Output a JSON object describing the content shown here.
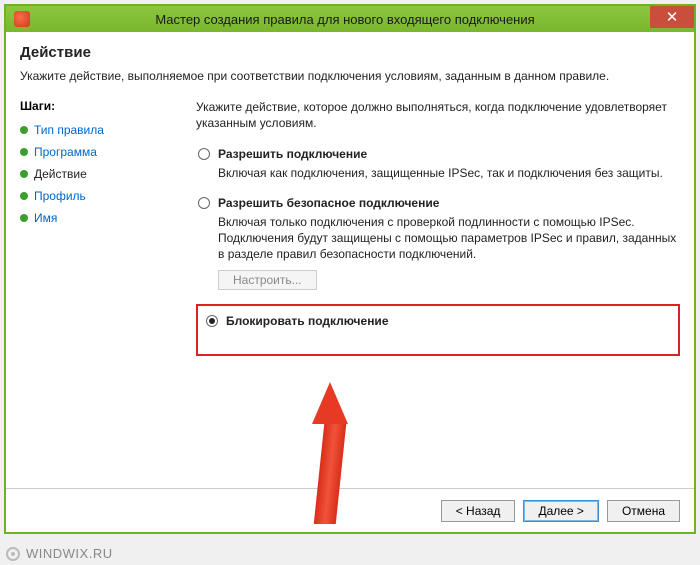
{
  "window": {
    "title": "Мастер создания правила для нового входящего подключения"
  },
  "header": {
    "title": "Действие",
    "subtitle": "Укажите действие, выполняемое при соответствии подключения условиям, заданным в данном правиле."
  },
  "sidebar": {
    "label": "Шаги:",
    "items": [
      {
        "label": "Тип правила",
        "current": false
      },
      {
        "label": "Программа",
        "current": false
      },
      {
        "label": "Действие",
        "current": true
      },
      {
        "label": "Профиль",
        "current": false
      },
      {
        "label": "Имя",
        "current": false
      }
    ]
  },
  "main": {
    "instruction": "Укажите действие, которое должно выполняться, когда подключение удовлетворяет указанным условиям.",
    "options": [
      {
        "label": "Разрешить подключение",
        "desc": "Включая как подключения, защищенные IPSec, так и подключения без защиты.",
        "checked": false
      },
      {
        "label": "Разрешить безопасное подключение",
        "desc": "Включая только подключения с проверкой подлинности с помощью IPSec. Подключения будут защищены с помощью параметров IPSec и правил, заданных в разделе правил безопасности подключений.",
        "checked": false
      },
      {
        "label": "Блокировать подключение",
        "desc": "",
        "checked": true
      }
    ],
    "configure_label": "Настроить..."
  },
  "footer": {
    "back": "< Назад",
    "next": "Далее >",
    "cancel": "Отмена"
  },
  "watermark": "WINDWIX.RU"
}
